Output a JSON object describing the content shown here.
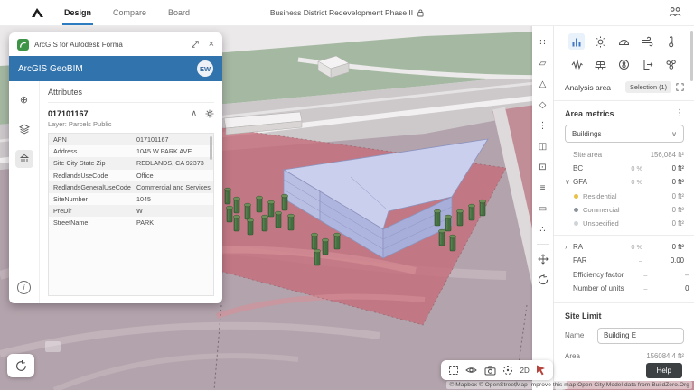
{
  "colors": {
    "tab_underline_blue": "#2d7cc0",
    "arcgis_blue": "#3173ad",
    "selected_parcel_red": "#c56c78",
    "building_lavender": "#cacfee",
    "residential_dot": "#e8c04a",
    "commercial_dot": "#8b949c",
    "unspecified_dot": "#cfd4d8",
    "help_button_bg": "#3c4043",
    "active_analysis_icon": "#4579c6"
  },
  "topbar": {
    "tabs": [
      {
        "label": "Design",
        "active": true
      },
      {
        "label": "Compare",
        "active": false
      },
      {
        "label": "Board",
        "active": false
      }
    ],
    "title": "Business District Redevelopment Phase II"
  },
  "arcgis_panel": {
    "window_title": "ArcGIS for Autodesk Forma",
    "app_title": "ArcGIS GeoBIM",
    "avatar_initials": "EW",
    "attributes_title": "Attributes",
    "feature_id": "017101167",
    "layer_label": "Layer: Parcels Public",
    "attributes": [
      {
        "key": "APN",
        "value": "017101167"
      },
      {
        "key": "Address",
        "value": "1045 W PARK AVE"
      },
      {
        "key": "Site City State Zip",
        "value": "REDLANDS, CA 92373"
      },
      {
        "key": "RedlandsUseCode",
        "value": "Office"
      },
      {
        "key": "RedlandsGeneralUseCode",
        "value": "Commercial and Services"
      },
      {
        "key": "SiteNumber",
        "value": "1045"
      },
      {
        "key": "PreDir",
        "value": "W"
      },
      {
        "key": "StreetName",
        "value": "PARK"
      }
    ]
  },
  "tools": {
    "side": [
      {
        "name": "multi-select-tool",
        "glyph": "∷"
      },
      {
        "name": "box-draw-tool",
        "glyph": "▱"
      },
      {
        "name": "polygon-draw-tool",
        "glyph": "△"
      },
      {
        "name": "plane-tool",
        "glyph": "◇"
      },
      {
        "name": "path-tool",
        "glyph": "⋮"
      },
      {
        "name": "stack-tool",
        "glyph": "◫"
      },
      {
        "name": "extrude-tool",
        "glyph": "⊡"
      },
      {
        "name": "levels-tool",
        "glyph": "≡"
      },
      {
        "name": "label-tool",
        "glyph": "▭"
      },
      {
        "name": "group-tool",
        "glyph": "∴"
      }
    ],
    "move_tool": "move-tool",
    "rotate_tool": "rotate-tool"
  },
  "right_panel": {
    "analysis_area_label": "Analysis area",
    "selection_label": "Selection (1)",
    "area_metrics_title": "Area metrics",
    "building_type_select": "Buildings",
    "metrics": [
      {
        "label": "Site area",
        "pct": "",
        "value": "156,084 ft²"
      },
      {
        "label": "BC",
        "pct": "0 %",
        "value": "0 ft²"
      },
      {
        "label": "GFA",
        "pct": "0 %",
        "value": "0 ft²"
      },
      {
        "label": "Residential",
        "pct": "",
        "value": "0 ft²"
      },
      {
        "label": "Commercial",
        "pct": "",
        "value": "0 ft²"
      },
      {
        "label": "Unspecified",
        "pct": "",
        "value": "0 ft²"
      },
      {
        "label": "RA",
        "pct": "0 %",
        "value": "0 ft²"
      },
      {
        "label": "FAR",
        "pct": "–",
        "value": "0.00"
      },
      {
        "label": "Efficiency factor",
        "pct": "–",
        "value": "–"
      },
      {
        "label": "Number of units",
        "pct": "–",
        "value": "0"
      }
    ],
    "site_limit": {
      "title": "Site Limit",
      "name_label": "Name",
      "name_value": "Building E",
      "area_label": "Area",
      "area_value": "156084.4 ft²"
    },
    "help_label": "Help"
  },
  "viewport": {
    "mode_2d_label": "2D",
    "attribution": "© Mapbox © OpenStreetMap Improve this map Open City Model data from BuildZero.Org"
  },
  "glyphs": {
    "close": "×",
    "chevron_up": "∧",
    "chevron_down": "∨",
    "chevron_right": "›",
    "kebab": "⋮",
    "add": "⊕",
    "info": "i"
  }
}
